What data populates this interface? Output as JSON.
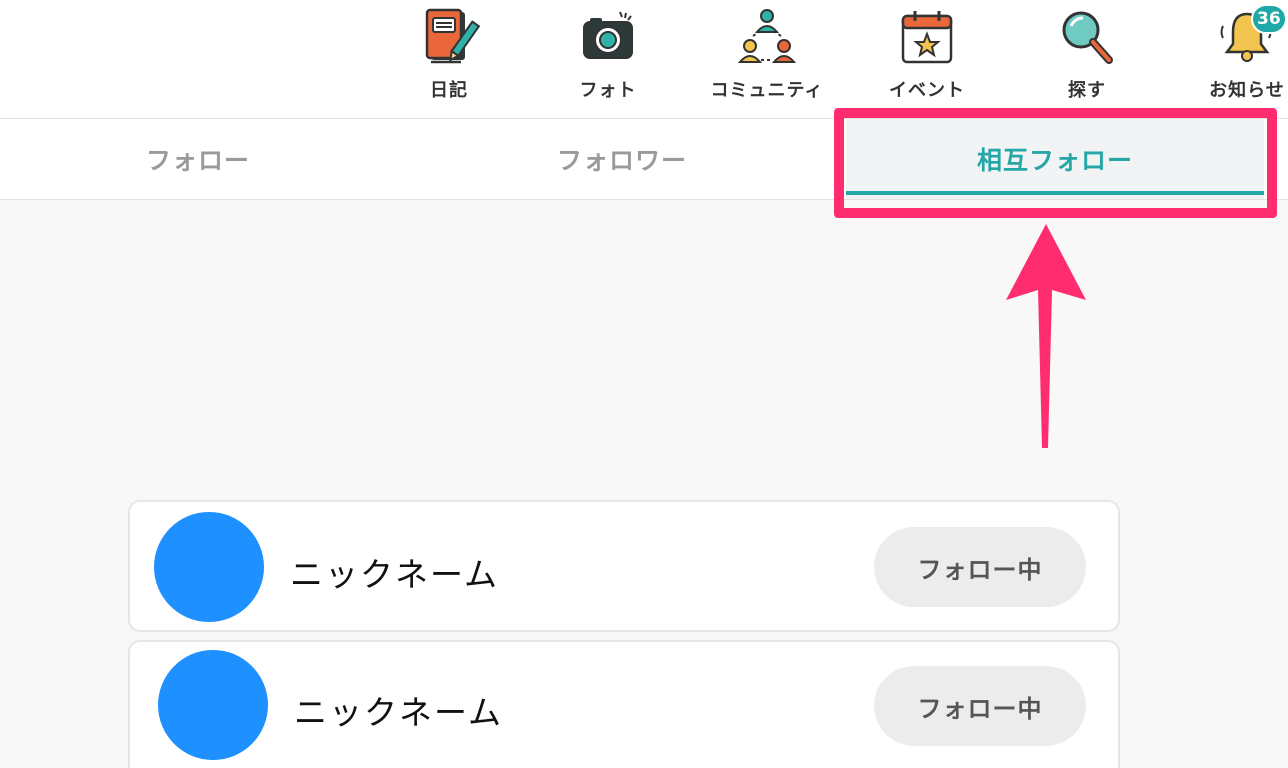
{
  "nav": {
    "items": [
      {
        "label": "日記",
        "icon": "diary-icon"
      },
      {
        "label": "フォト",
        "icon": "camera-icon"
      },
      {
        "label": "コミュニティ",
        "icon": "community-icon"
      },
      {
        "label": "イベント",
        "icon": "calendar-icon"
      },
      {
        "label": "探す",
        "icon": "magnifier-icon"
      },
      {
        "label": "お知らせ",
        "icon": "bell-icon",
        "badge": "36"
      }
    ]
  },
  "tabs": [
    {
      "label": "フォロー"
    },
    {
      "label": "フォロワー"
    },
    {
      "label": "相互フォロー",
      "active": true
    }
  ],
  "list": [
    {
      "name": "ニックネーム",
      "button": "フォロー中"
    },
    {
      "name": "ニックネーム",
      "button": "フォロー中"
    }
  ],
  "colors": {
    "accent": "#25a7a7",
    "highlight": "#ff2d6f",
    "avatar": "#1e90ff",
    "badge": "#1fa8a8"
  }
}
